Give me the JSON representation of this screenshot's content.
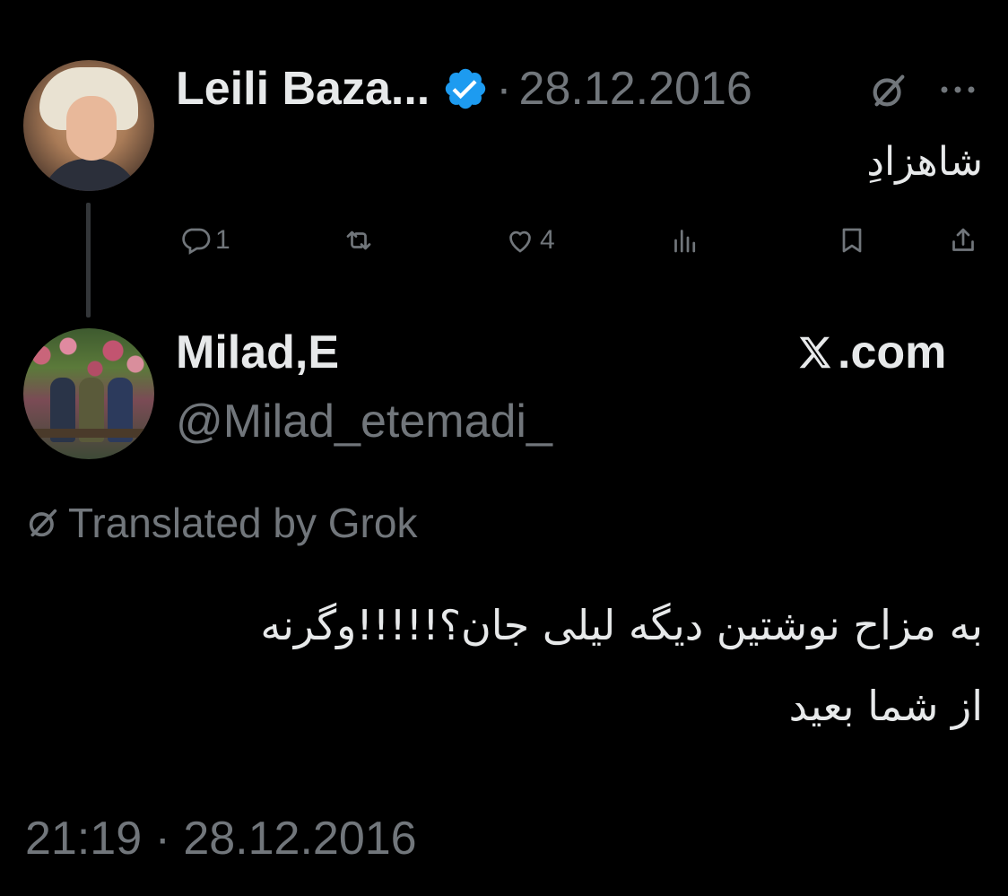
{
  "parent_tweet": {
    "display_name": "Leili Baza...",
    "dot": "·",
    "date": "28.12.2016",
    "text": "شاهزادِ",
    "actions": {
      "reply_count": "1",
      "repost_count": "",
      "like_count": "4",
      "views_count": ""
    }
  },
  "main_tweet": {
    "display_name": "Milad,E",
    "handle": "@Milad_etemadi_",
    "brand": ".com",
    "translated_label": "Translated by Grok",
    "text_lines": [
      "به مزاح نوشتین دیگه لیلی جان؟!!!!!وگرنه",
      "از شما بعید"
    ],
    "timestamp": "21:19 · 28.12.2016"
  },
  "colors": {
    "background": "#000000",
    "primary_text": "#e7e9ea",
    "secondary_text": "#71767b",
    "verified_blue": "#1d9bf0",
    "thread_line": "#333639"
  },
  "icons": [
    "verified-badge-icon",
    "grok-icon",
    "more-icon",
    "reply-icon",
    "repost-icon",
    "like-icon",
    "views-icon",
    "bookmark-icon",
    "share-icon",
    "x-logo-icon"
  ]
}
